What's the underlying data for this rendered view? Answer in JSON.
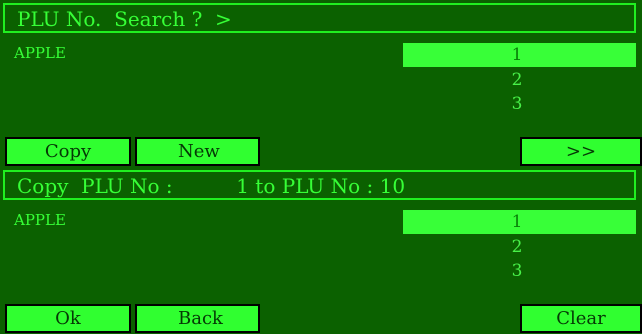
{
  "panels": [
    {
      "title": "PLU No.  Search ?  >",
      "item": "APPLE",
      "numbers": [
        "1",
        "2",
        "3"
      ],
      "buttons": [
        "Copy",
        "New",
        ">>"
      ]
    },
    {
      "title": "Copy  PLU No :          1 to PLU No : 10",
      "item": "APPLE",
      "numbers": [
        "1",
        "2",
        "3"
      ],
      "buttons": [
        "Ok",
        "Back",
        "Clear"
      ]
    }
  ],
  "colors": {
    "background": "#0b6100",
    "highlight": "#38ff38",
    "text": "#36ff36",
    "border": "#20f020"
  }
}
